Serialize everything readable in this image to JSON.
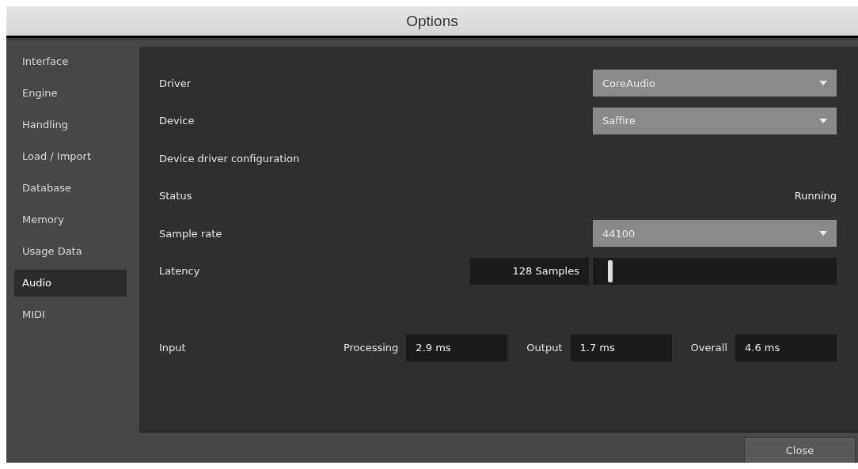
{
  "window": {
    "title": "Options"
  },
  "sidebar": {
    "items": [
      {
        "label": "Interface",
        "selected": false
      },
      {
        "label": "Engine",
        "selected": false
      },
      {
        "label": "Handling",
        "selected": false
      },
      {
        "label": "Load / Import",
        "selected": false
      },
      {
        "label": "Database",
        "selected": false
      },
      {
        "label": "Memory",
        "selected": false
      },
      {
        "label": "Usage Data",
        "selected": false
      },
      {
        "label": "Audio",
        "selected": true
      },
      {
        "label": "MIDI",
        "selected": false
      }
    ]
  },
  "settings": [
    {
      "kind": "dropdown",
      "label": "Driver",
      "value": "CoreAudio"
    },
    {
      "kind": "dropdown",
      "label": "Device",
      "value": "Saffire"
    },
    {
      "kind": "label",
      "label": "Device driver configuration"
    },
    {
      "kind": "status",
      "label": "Status",
      "value": "Running"
    },
    {
      "kind": "dropdown",
      "label": "Sample rate",
      "value": "44100"
    },
    {
      "kind": "slider",
      "label": "Latency",
      "value": "128 Samples",
      "level": 0.05
    }
  ],
  "latency_readout": {
    "label": "Input",
    "fields": [
      {
        "label": "Processing",
        "value": "2.9 ms"
      },
      {
        "label": "Output",
        "value": "1.7 ms"
      },
      {
        "label": "Overall",
        "value": "4.6 ms"
      }
    ]
  },
  "buttons": [
    {
      "label": "Close"
    }
  ]
}
